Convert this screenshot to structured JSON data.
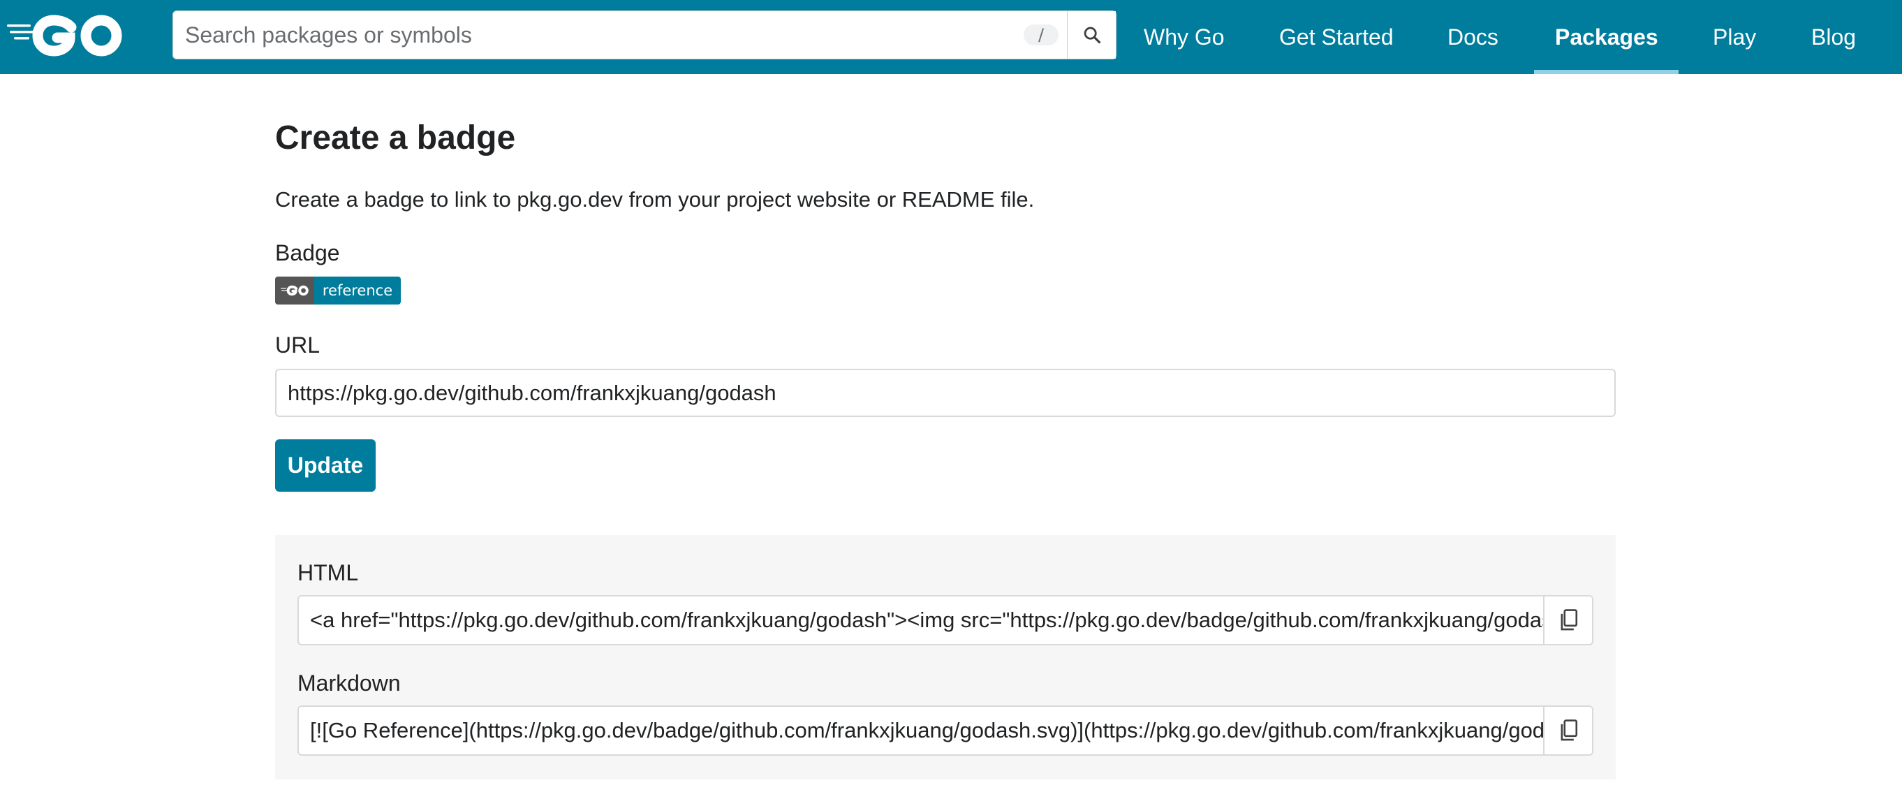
{
  "header": {
    "logo_text": "GO",
    "search": {
      "placeholder": "Search packages or symbols",
      "shortcut_key": "/"
    },
    "nav": [
      {
        "label": "Why Go",
        "active": false
      },
      {
        "label": "Get Started",
        "active": false
      },
      {
        "label": "Docs",
        "active": false
      },
      {
        "label": "Packages",
        "active": true
      },
      {
        "label": "Play",
        "active": false
      },
      {
        "label": "Blog",
        "active": false
      }
    ]
  },
  "main": {
    "title": "Create a badge",
    "description": "Create a badge to link to pkg.go.dev from your project website or README file.",
    "badge_label": "Badge",
    "badge": {
      "left_text": "GO",
      "right_text": "reference"
    },
    "url_label": "URL",
    "url_value": "https://pkg.go.dev/github.com/frankxjkuang/godash",
    "update_label": "Update",
    "html_label": "HTML",
    "html_snippet": "<a href=\"https://pkg.go.dev/github.com/frankxjkuang/godash\"><img src=\"https://pkg.go.dev/badge/github.com/frankxjkuang/godash.svg\" alt=\"Go Reference\"></a>",
    "markdown_label": "Markdown",
    "markdown_snippet": "[![Go Reference](https://pkg.go.dev/badge/github.com/frankxjkuang/godash.svg)](https://pkg.go.dev/github.com/frankxjkuang/godash)"
  },
  "colors": {
    "brand": "#007d9c",
    "active_underline": "#8fd1e6",
    "badge_left": "#555555",
    "panel_bg": "#f6f6f6"
  },
  "icons": {
    "logo": "go-logo-icon",
    "search": "search-icon",
    "copy": "copy-icon"
  }
}
